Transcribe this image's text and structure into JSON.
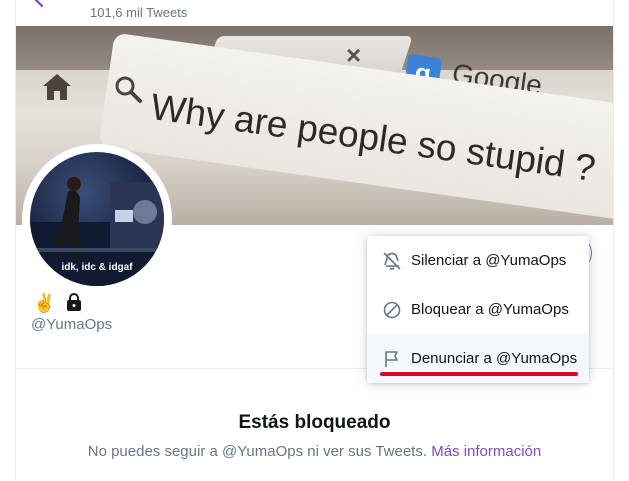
{
  "header": {
    "tweet_count": "101,6 mil Tweets"
  },
  "banner": {
    "search_text": "Why are people so stupid ?",
    "tab_brand": "Google",
    "logo_letter": "g",
    "close_glyph": "×"
  },
  "profile": {
    "avatar_text": "idk, idc & idgaf",
    "emoji": "✌️",
    "handle": "@YumaOps"
  },
  "menu": {
    "items": [
      {
        "label": "Silenciar a @YumaOps",
        "icon": "mute-icon"
      },
      {
        "label": "Bloquear a @YumaOps",
        "icon": "block-icon"
      },
      {
        "label": "Denunciar a @YumaOps",
        "icon": "flag-icon"
      }
    ]
  },
  "blocked": {
    "title": "Estás bloqueado",
    "description": "No puedes seguir a @YumaOps ni ver sus Tweets.",
    "link": "Más información"
  },
  "colors": {
    "accent": "#794bc4",
    "annotation": "#e6001a",
    "muted": "#657786"
  }
}
